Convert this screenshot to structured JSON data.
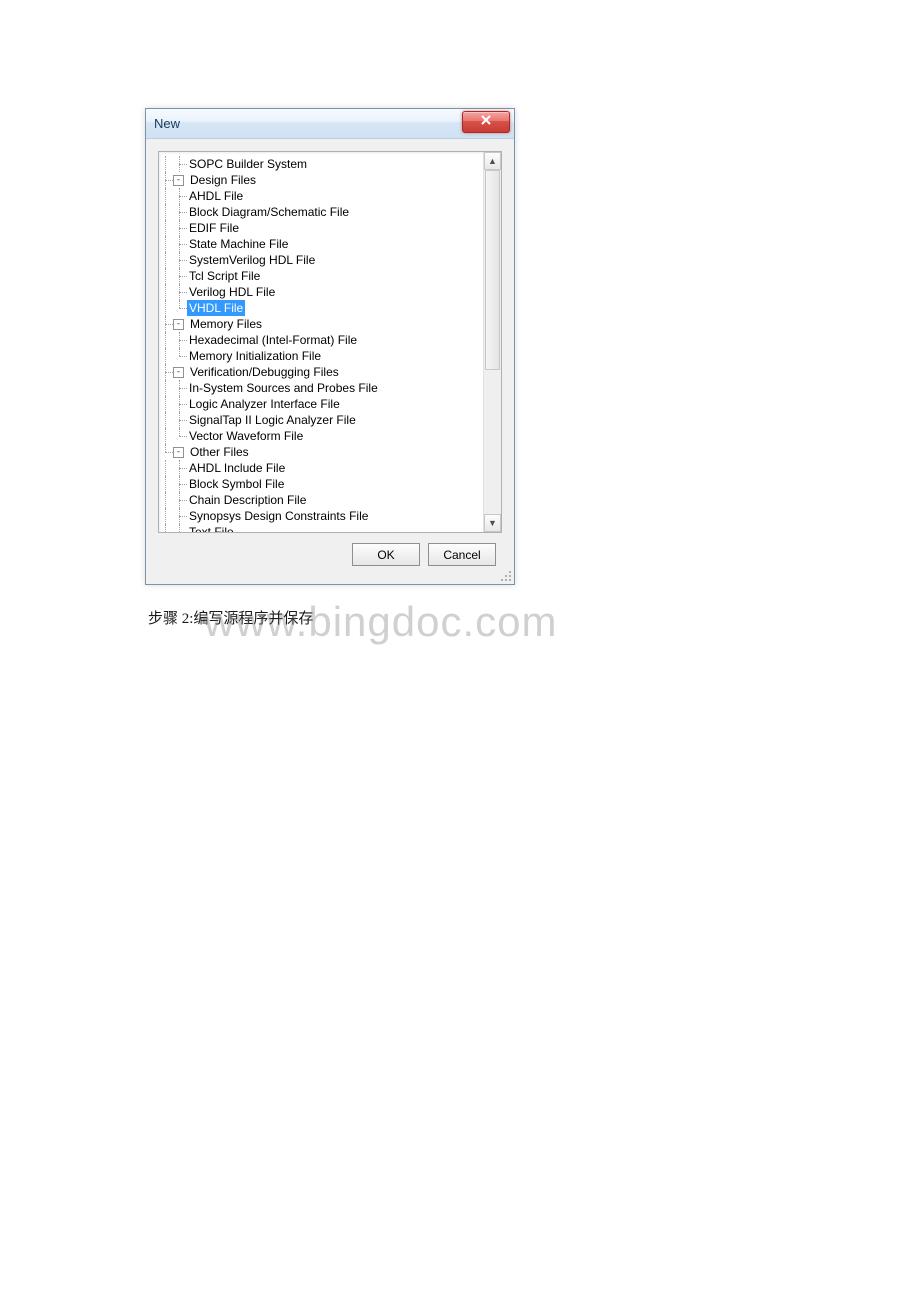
{
  "dialog": {
    "title": "New",
    "close_icon": "close-icon",
    "ok_label": "OK",
    "cancel_label": "Cancel"
  },
  "tree": {
    "top_item": "SOPC Builder System",
    "groups": [
      {
        "label": "Design Files",
        "children": [
          "AHDL File",
          "Block Diagram/Schematic File",
          "EDIF File",
          "State Machine File",
          "SystemVerilog HDL File",
          "Tcl Script File",
          "Verilog HDL File",
          "VHDL File"
        ],
        "selected_index": 7
      },
      {
        "label": "Memory Files",
        "children": [
          "Hexadecimal (Intel-Format) File",
          "Memory Initialization File"
        ]
      },
      {
        "label": "Verification/Debugging Files",
        "children": [
          "In-System Sources and Probes File",
          "Logic Analyzer Interface File",
          "SignalTap II Logic Analyzer File",
          "Vector Waveform File"
        ]
      },
      {
        "label": "Other Files",
        "children": [
          "AHDL Include File",
          "Block Symbol File",
          "Chain Description File",
          "Synopsys Design Constraints File",
          "Text File"
        ]
      }
    ]
  },
  "caption": "步骤 2:编写源程序并保存",
  "watermark": "www.bingdoc.com"
}
